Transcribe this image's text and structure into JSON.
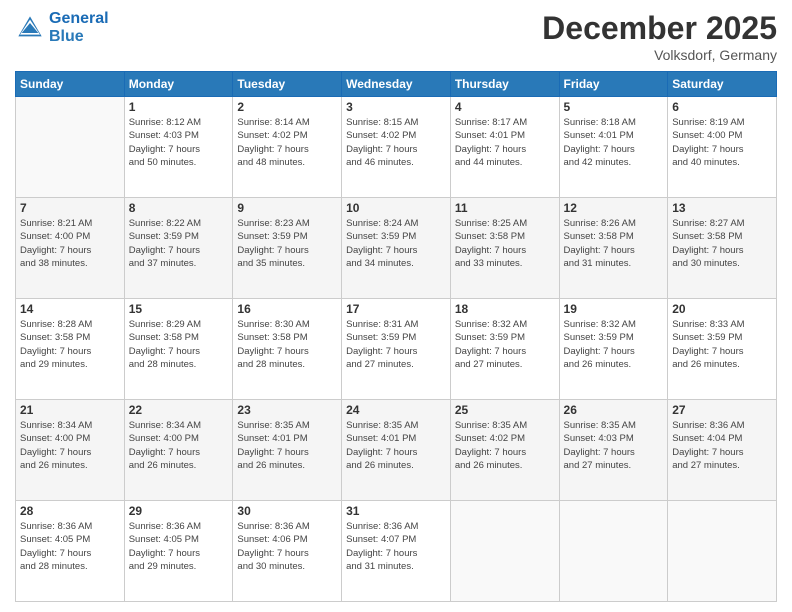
{
  "logo": {
    "line1": "General",
    "line2": "Blue"
  },
  "header": {
    "month": "December 2025",
    "location": "Volksdorf, Germany"
  },
  "weekdays": [
    "Sunday",
    "Monday",
    "Tuesday",
    "Wednesday",
    "Thursday",
    "Friday",
    "Saturday"
  ],
  "weeks": [
    [
      {
        "day": "",
        "info": ""
      },
      {
        "day": "1",
        "info": "Sunrise: 8:12 AM\nSunset: 4:03 PM\nDaylight: 7 hours\nand 50 minutes."
      },
      {
        "day": "2",
        "info": "Sunrise: 8:14 AM\nSunset: 4:02 PM\nDaylight: 7 hours\nand 48 minutes."
      },
      {
        "day": "3",
        "info": "Sunrise: 8:15 AM\nSunset: 4:02 PM\nDaylight: 7 hours\nand 46 minutes."
      },
      {
        "day": "4",
        "info": "Sunrise: 8:17 AM\nSunset: 4:01 PM\nDaylight: 7 hours\nand 44 minutes."
      },
      {
        "day": "5",
        "info": "Sunrise: 8:18 AM\nSunset: 4:01 PM\nDaylight: 7 hours\nand 42 minutes."
      },
      {
        "day": "6",
        "info": "Sunrise: 8:19 AM\nSunset: 4:00 PM\nDaylight: 7 hours\nand 40 minutes."
      }
    ],
    [
      {
        "day": "7",
        "info": "Sunrise: 8:21 AM\nSunset: 4:00 PM\nDaylight: 7 hours\nand 38 minutes."
      },
      {
        "day": "8",
        "info": "Sunrise: 8:22 AM\nSunset: 3:59 PM\nDaylight: 7 hours\nand 37 minutes."
      },
      {
        "day": "9",
        "info": "Sunrise: 8:23 AM\nSunset: 3:59 PM\nDaylight: 7 hours\nand 35 minutes."
      },
      {
        "day": "10",
        "info": "Sunrise: 8:24 AM\nSunset: 3:59 PM\nDaylight: 7 hours\nand 34 minutes."
      },
      {
        "day": "11",
        "info": "Sunrise: 8:25 AM\nSunset: 3:58 PM\nDaylight: 7 hours\nand 33 minutes."
      },
      {
        "day": "12",
        "info": "Sunrise: 8:26 AM\nSunset: 3:58 PM\nDaylight: 7 hours\nand 31 minutes."
      },
      {
        "day": "13",
        "info": "Sunrise: 8:27 AM\nSunset: 3:58 PM\nDaylight: 7 hours\nand 30 minutes."
      }
    ],
    [
      {
        "day": "14",
        "info": "Sunrise: 8:28 AM\nSunset: 3:58 PM\nDaylight: 7 hours\nand 29 minutes."
      },
      {
        "day": "15",
        "info": "Sunrise: 8:29 AM\nSunset: 3:58 PM\nDaylight: 7 hours\nand 28 minutes."
      },
      {
        "day": "16",
        "info": "Sunrise: 8:30 AM\nSunset: 3:58 PM\nDaylight: 7 hours\nand 28 minutes."
      },
      {
        "day": "17",
        "info": "Sunrise: 8:31 AM\nSunset: 3:59 PM\nDaylight: 7 hours\nand 27 minutes."
      },
      {
        "day": "18",
        "info": "Sunrise: 8:32 AM\nSunset: 3:59 PM\nDaylight: 7 hours\nand 27 minutes."
      },
      {
        "day": "19",
        "info": "Sunrise: 8:32 AM\nSunset: 3:59 PM\nDaylight: 7 hours\nand 26 minutes."
      },
      {
        "day": "20",
        "info": "Sunrise: 8:33 AM\nSunset: 3:59 PM\nDaylight: 7 hours\nand 26 minutes."
      }
    ],
    [
      {
        "day": "21",
        "info": "Sunrise: 8:34 AM\nSunset: 4:00 PM\nDaylight: 7 hours\nand 26 minutes."
      },
      {
        "day": "22",
        "info": "Sunrise: 8:34 AM\nSunset: 4:00 PM\nDaylight: 7 hours\nand 26 minutes."
      },
      {
        "day": "23",
        "info": "Sunrise: 8:35 AM\nSunset: 4:01 PM\nDaylight: 7 hours\nand 26 minutes."
      },
      {
        "day": "24",
        "info": "Sunrise: 8:35 AM\nSunset: 4:01 PM\nDaylight: 7 hours\nand 26 minutes."
      },
      {
        "day": "25",
        "info": "Sunrise: 8:35 AM\nSunset: 4:02 PM\nDaylight: 7 hours\nand 26 minutes."
      },
      {
        "day": "26",
        "info": "Sunrise: 8:35 AM\nSunset: 4:03 PM\nDaylight: 7 hours\nand 27 minutes."
      },
      {
        "day": "27",
        "info": "Sunrise: 8:36 AM\nSunset: 4:04 PM\nDaylight: 7 hours\nand 27 minutes."
      }
    ],
    [
      {
        "day": "28",
        "info": "Sunrise: 8:36 AM\nSunset: 4:05 PM\nDaylight: 7 hours\nand 28 minutes."
      },
      {
        "day": "29",
        "info": "Sunrise: 8:36 AM\nSunset: 4:05 PM\nDaylight: 7 hours\nand 29 minutes."
      },
      {
        "day": "30",
        "info": "Sunrise: 8:36 AM\nSunset: 4:06 PM\nDaylight: 7 hours\nand 30 minutes."
      },
      {
        "day": "31",
        "info": "Sunrise: 8:36 AM\nSunset: 4:07 PM\nDaylight: 7 hours\nand 31 minutes."
      },
      {
        "day": "",
        "info": ""
      },
      {
        "day": "",
        "info": ""
      },
      {
        "day": "",
        "info": ""
      }
    ]
  ]
}
